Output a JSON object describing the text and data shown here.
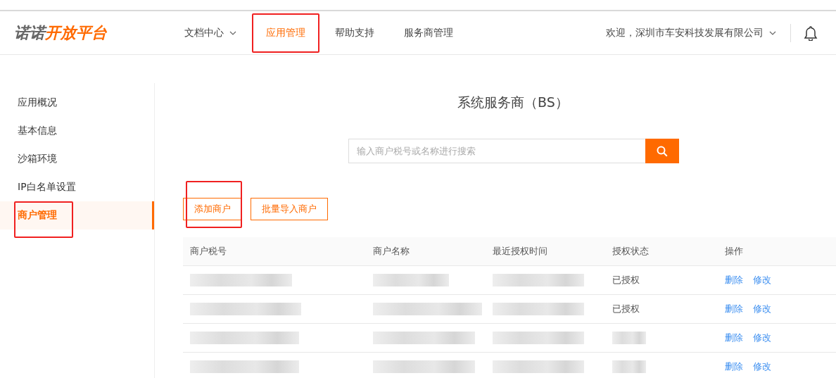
{
  "logo": {
    "part_1": "诺诺",
    "part_2": "开放平台"
  },
  "nav": [
    {
      "label": "文档中心",
      "dropdown": true,
      "selected": false,
      "annotated": false
    },
    {
      "label": "应用管理",
      "dropdown": false,
      "selected": true,
      "annotated": true
    },
    {
      "label": "帮助支持",
      "dropdown": false,
      "selected": false,
      "annotated": false
    },
    {
      "label": "服务商管理",
      "dropdown": false,
      "selected": false,
      "annotated": false
    }
  ],
  "user": {
    "greeting": "欢迎，深圳市车安科技发展有限公司"
  },
  "sidebar": {
    "items": [
      {
        "label": "应用概况",
        "selected": false,
        "annotated": false
      },
      {
        "label": "基本信息",
        "selected": false,
        "annotated": false
      },
      {
        "label": "沙箱环境",
        "selected": false,
        "annotated": false
      },
      {
        "label": "IP白名单设置",
        "selected": false,
        "annotated": false
      },
      {
        "label": "商户管理",
        "selected": true,
        "annotated": true
      }
    ]
  },
  "page_title": "系统服务商（BS）",
  "search": {
    "placeholder": "输入商户税号或名称进行搜索"
  },
  "buttons": [
    {
      "label": "添加商户",
      "annotated": true
    },
    {
      "label": "批量导入商户",
      "annotated": false
    }
  ],
  "table": {
    "columns": [
      "商户税号",
      "商户名称",
      "最近授权时间",
      "授权状态",
      "操作"
    ],
    "rows": [
      {
        "status": "已授权",
        "actions": [
          "删除",
          "修改"
        ]
      },
      {
        "status": "已授权",
        "actions": [
          "删除",
          "修改"
        ]
      },
      {
        "actions": [
          "删除",
          "修改"
        ]
      },
      {
        "actions": [
          "删除",
          "修改"
        ]
      }
    ]
  }
}
